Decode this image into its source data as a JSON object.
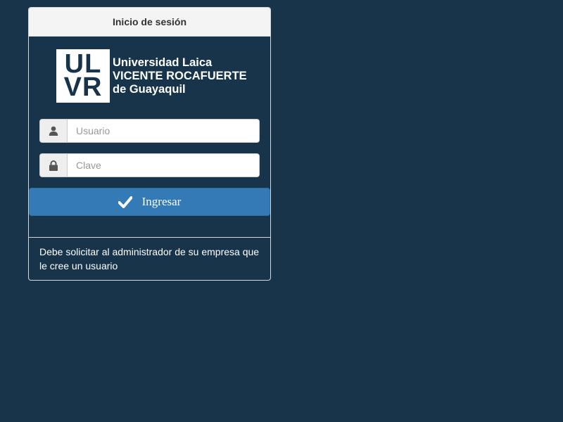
{
  "panel": {
    "title": "Inicio de sesión"
  },
  "logo": {
    "mark_line1": "UL",
    "mark_line2": "VR",
    "text_line1": "Universidad Laica",
    "text_line2": "VICENTE ROCAFUERTE",
    "text_line3": "de Guayaquil"
  },
  "form": {
    "username_placeholder": "Usuario",
    "username_value": "",
    "username_icon": "user-icon",
    "password_placeholder": "Clave",
    "password_value": "",
    "password_icon": "lock-icon",
    "submit_label": "Ingresar",
    "submit_icon": "checkmark-icon"
  },
  "footer": {
    "text": "Debe solicitar al administrador de su empresa que le cree un usuario"
  },
  "colors": {
    "background": "#17344b",
    "button": "#337ab7",
    "heading_bg": "#f4f4f4"
  }
}
